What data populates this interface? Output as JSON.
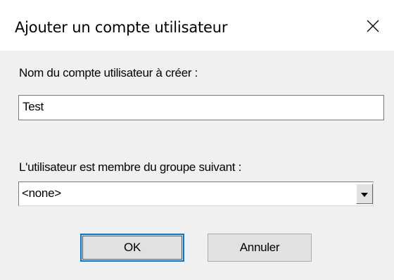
{
  "window": {
    "title": "Ajouter un compte utilisateur",
    "close_icon": "close-icon"
  },
  "form": {
    "account_label": "Nom du compte utilisateur à créer :",
    "account_value": "Test",
    "group_label": "L'utilisateur est membre du groupe suivant :",
    "group_selected": "<none>",
    "group_arrow_icon": "chevron-down-icon"
  },
  "buttons": {
    "ok_label": "OK",
    "cancel_label": "Annuler"
  },
  "colors": {
    "client_background": "#f0f0f0",
    "focus_border": "#0078d7",
    "button_face": "#e1e1e1"
  }
}
